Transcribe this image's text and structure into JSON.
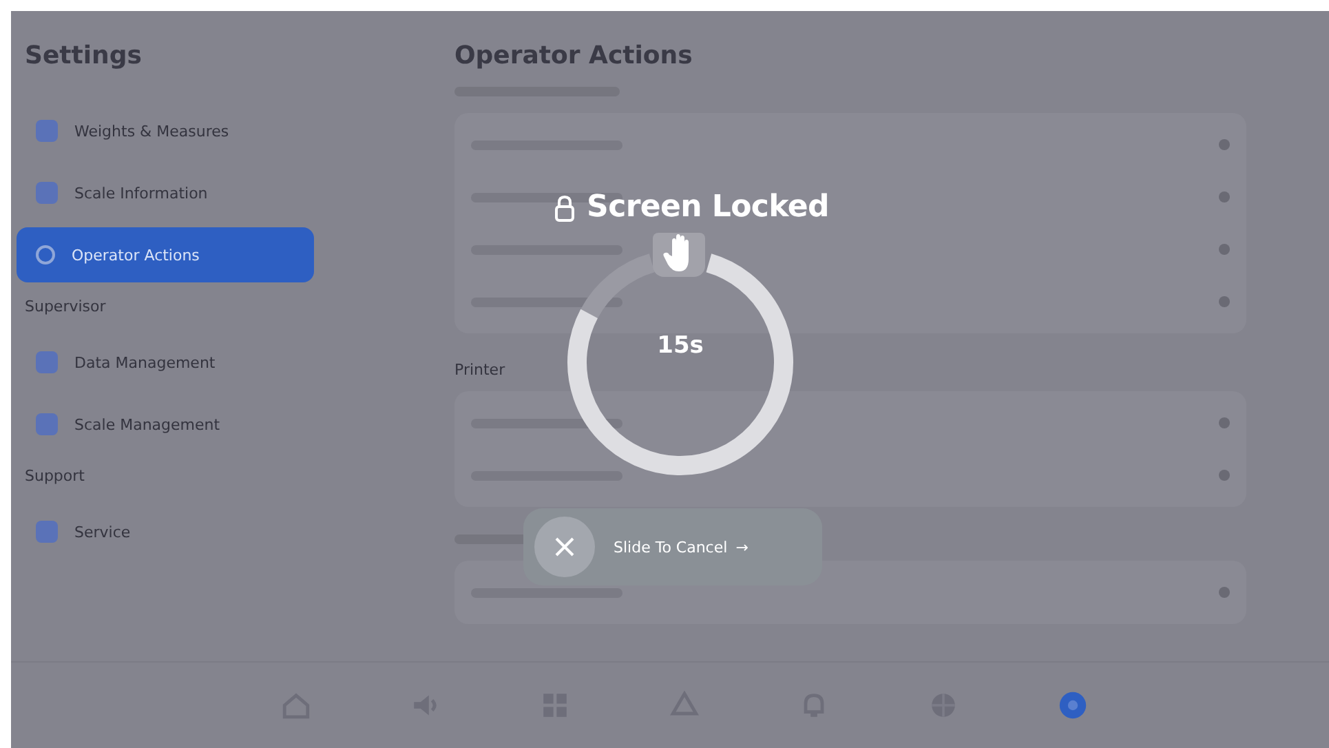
{
  "sidebar": {
    "title": "Settings",
    "entries": [
      {
        "kind": "item",
        "label": "Weights & Measures",
        "selected": false
      },
      {
        "kind": "item",
        "label": "Scale Information",
        "selected": false
      },
      {
        "kind": "item",
        "label": "Operator Actions",
        "selected": true
      },
      {
        "kind": "heading",
        "label": "Supervisor"
      },
      {
        "kind": "item",
        "label": "Data Management",
        "selected": false
      },
      {
        "kind": "item",
        "label": "Scale Management",
        "selected": false
      },
      {
        "kind": "heading",
        "label": "Support"
      },
      {
        "kind": "item",
        "label": "Service",
        "selected": false
      }
    ]
  },
  "main": {
    "title": "Operator Actions",
    "sections": [
      {
        "kind": "blurred",
        "rows": [
          {
            "kind": "blurred"
          },
          {
            "kind": "blurred"
          },
          {
            "kind": "blurred"
          },
          {
            "kind": "blurred"
          }
        ]
      },
      {
        "kind": "titled",
        "heading": "Printer",
        "rows": [
          {
            "kind": "blurred"
          },
          {
            "kind": "blurred"
          }
        ]
      },
      {
        "kind": "blurred",
        "rows": [
          {
            "kind": "blurred"
          }
        ]
      }
    ]
  },
  "bottom_nav": {
    "items": [
      {
        "selected": false
      },
      {
        "selected": false
      },
      {
        "selected": false
      },
      {
        "selected": false
      },
      {
        "selected": false
      },
      {
        "selected": false
      },
      {
        "selected": true
      }
    ]
  },
  "lock_overlay": {
    "title": "Screen Locked",
    "countdown": "15s",
    "slider": {
      "label": "Slide To Cancel",
      "arrow": "→"
    }
  }
}
